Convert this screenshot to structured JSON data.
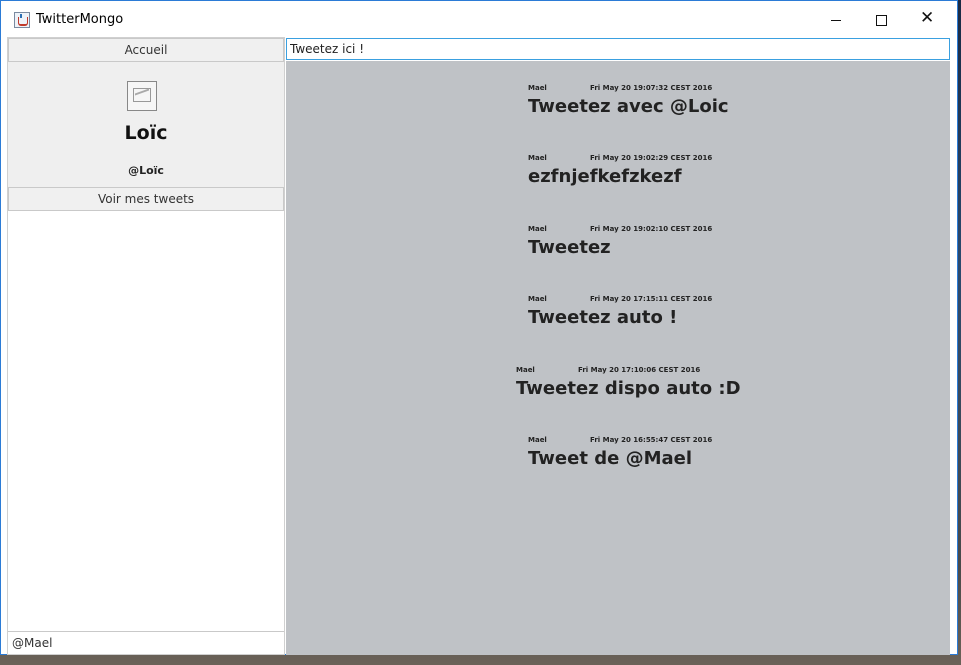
{
  "window": {
    "title": "TwitterMongo",
    "controls": {
      "minimize": "minimize-icon",
      "maximize": "maximize-icon",
      "close": "close-icon"
    }
  },
  "sidebar": {
    "home_button": "Accueil",
    "profile": {
      "avatar_icon": "image-placeholder-icon",
      "name": "Loïc",
      "handle": "@Loïc"
    },
    "my_tweets_button": "Voir mes tweets",
    "current_user": "@Mael"
  },
  "composer": {
    "value": "Tweetez ici !"
  },
  "feed": {
    "tweets": [
      {
        "author": "Mael",
        "date": "Fri May 20 19:07:32 CEST 2016",
        "text": "Tweetez avec @Loic"
      },
      {
        "author": "Mael",
        "date": "Fri May 20 19:02:29 CEST 2016",
        "text": "ezfnjefkefzkezf"
      },
      {
        "author": "Mael",
        "date": "Fri May 20 19:02:10 CEST 2016",
        "text": "Tweetez"
      },
      {
        "author": "Mael",
        "date": "Fri May 20 17:15:11 CEST 2016",
        "text": "Tweetez auto !"
      },
      {
        "author": "Mael",
        "date": "Fri May 20 17:10:06 CEST 2016",
        "text": "Tweetez dispo auto :D"
      },
      {
        "author": "Mael",
        "date": "Fri May 20 16:55:47 CEST 2016",
        "text": "Tweet de @Mael"
      }
    ]
  }
}
